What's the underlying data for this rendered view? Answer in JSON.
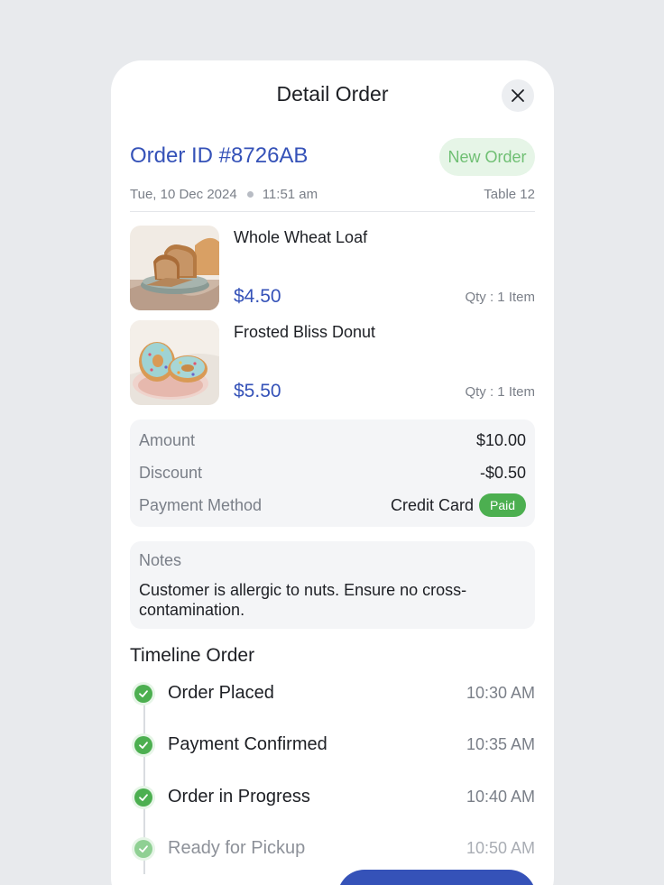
{
  "header": {
    "title": "Detail Order"
  },
  "order": {
    "id": "Order ID #8726AB",
    "status": "New Order",
    "date": "Tue, 10 Dec 2024",
    "time": "11:51 am",
    "table": "Table 12"
  },
  "items": [
    {
      "name": "Whole Wheat Loaf",
      "price": "$4.50",
      "qty": "Qty : 1 Item"
    },
    {
      "name": "Frosted Bliss Donut",
      "price": "$5.50",
      "qty": "Qty : 1 Item"
    }
  ],
  "summary": {
    "amount_label": "Amount",
    "amount_value": "$10.00",
    "discount_label": "Discount",
    "discount_value": "-$0.50",
    "payment_label": "Payment Method",
    "payment_value": "Credit Card",
    "payment_status": "Paid"
  },
  "notes": {
    "label": "Notes",
    "text": "Customer is allergic to nuts. Ensure no cross-contamination."
  },
  "timeline": {
    "title": "Timeline Order",
    "steps": [
      {
        "label": "Order Placed",
        "time": "10:30 AM"
      },
      {
        "label": "Payment Confirmed",
        "time": "10:35 AM"
      },
      {
        "label": "Order in Progress",
        "time": "10:40 AM"
      },
      {
        "label": "Ready for Pickup",
        "time": "10:50 AM"
      }
    ]
  },
  "colors": {
    "accent": "#3552b8",
    "success": "#4caf50",
    "background": "#e8eaed"
  },
  "icons": {
    "close": "close-icon",
    "check": "check-icon"
  }
}
